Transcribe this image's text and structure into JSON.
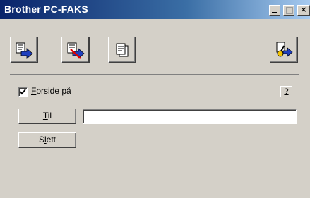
{
  "window": {
    "title": "Brother PC-FAKS",
    "controls": {
      "minimize_icon": "minimize-icon",
      "maximize_icon": "maximize-icon",
      "close_label": "×"
    }
  },
  "toolbar": {
    "buttons": [
      {
        "icon": "send-fax-icon"
      },
      {
        "icon": "cancel-send-icon"
      },
      {
        "icon": "copy-pages-icon"
      },
      {
        "icon": "settings-key-icon"
      }
    ]
  },
  "cover_page": {
    "checked": true,
    "label_accel": "F",
    "label_rest": "orside på"
  },
  "help": {
    "label": "?"
  },
  "to_button": {
    "label_accel": "T",
    "label_rest": "il"
  },
  "to_field": {
    "value": "",
    "placeholder": ""
  },
  "delete_button": {
    "label_pre": "S",
    "label_accel": "l",
    "label_rest": "ett"
  },
  "colors": {
    "face": "#d4d0c8",
    "titlebar": "#0a246a",
    "arrow": "#1f3fbf"
  }
}
